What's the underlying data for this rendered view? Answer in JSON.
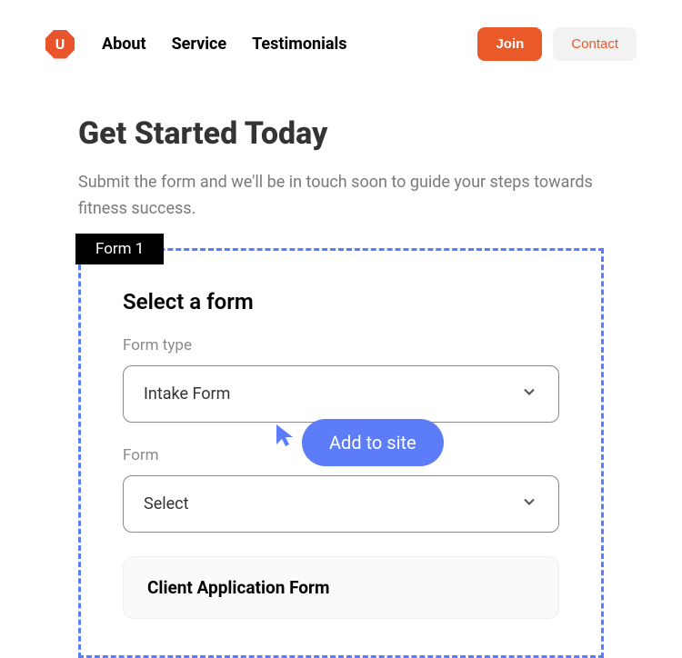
{
  "logo_letter": "U",
  "nav": {
    "about": "About",
    "service": "Service",
    "testimonials": "Testimonials",
    "join": "Join",
    "contact": "Contact"
  },
  "hero": {
    "title": "Get Started Today",
    "subtitle": "Submit the form and we'll be in touch soon to guide your steps towards fitness success."
  },
  "editor": {
    "block_label": "Form 1",
    "panel_title": "Select a form",
    "form_type_label": "Form type",
    "form_type_value": "Intake Form",
    "form_label": "Form",
    "form_value": "Select",
    "tooltip": "Add to site",
    "card_title": "Client Application Form"
  }
}
